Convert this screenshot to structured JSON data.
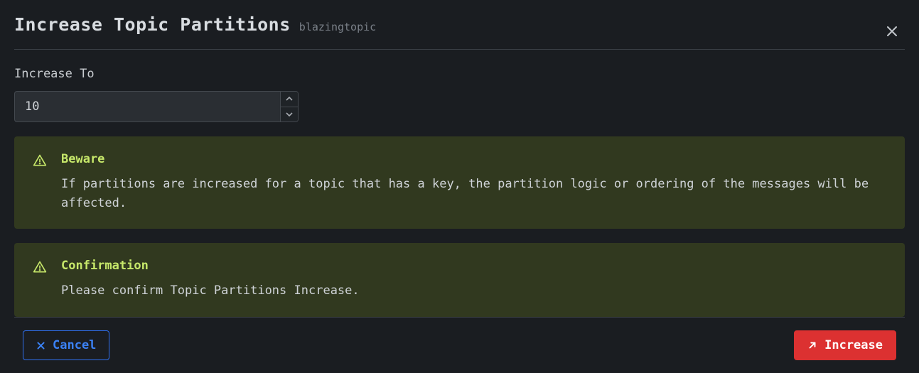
{
  "header": {
    "title": "Increase Topic Partitions",
    "topic_name": "blazingtopic"
  },
  "form": {
    "field_label": "Increase To",
    "value": "10"
  },
  "alerts": [
    {
      "title": "Beware",
      "body": "If partitions are increased for a topic that has a key, the partition logic or ordering of the messages will be affected."
    },
    {
      "title": "Confirmation",
      "body": "Please confirm Topic Partitions Increase."
    }
  ],
  "footer": {
    "cancel_label": "Cancel",
    "submit_label": "Increase"
  },
  "colors": {
    "accent_warning": "#c7e86a",
    "accent_primary": "#3b82f6",
    "accent_danger": "#dc3131",
    "alert_bg": "#31391f"
  }
}
